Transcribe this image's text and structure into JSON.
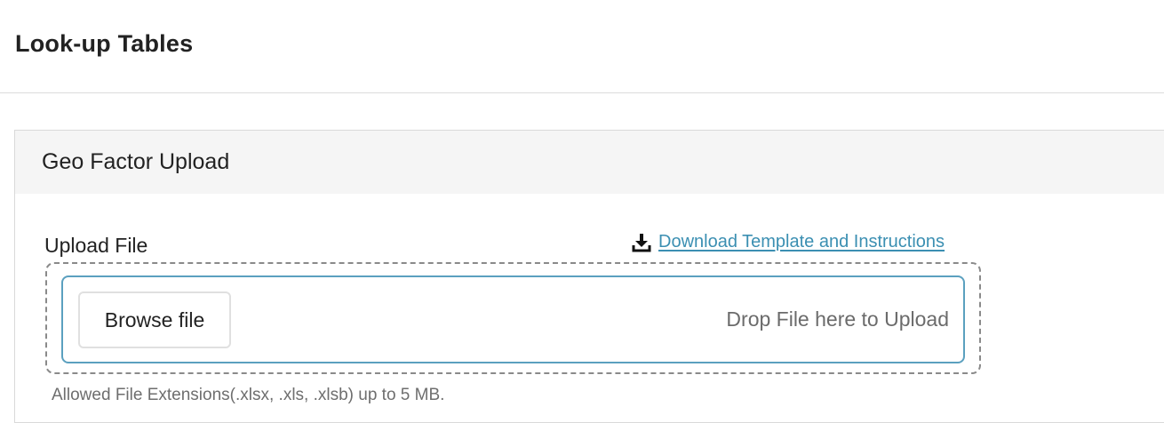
{
  "page": {
    "title": "Look-up Tables"
  },
  "card": {
    "title": "Geo Factor Upload",
    "upload_label": "Upload File",
    "download_link": {
      "label": "Download Template and Instructions",
      "icon": "download-icon"
    },
    "dropzone": {
      "browse_label": "Browse file",
      "drop_text": "Drop File here to Upload"
    },
    "allowed_text": "Allowed File Extensions(.xlsx, .xls, .xlsb) up to 5 MB."
  },
  "colors": {
    "link": "#3b8fb2",
    "dropzone_border": "#5ba0bf",
    "header_bg": "#f5f5f5"
  }
}
